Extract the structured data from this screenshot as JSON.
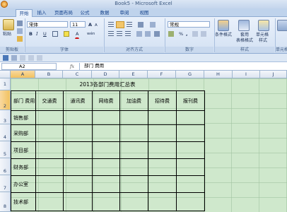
{
  "app": {
    "title": "Book5 - Microsoft Excel"
  },
  "tabs": [
    "开始",
    "插入",
    "页面布局",
    "公式",
    "数据",
    "审阅",
    "视图"
  ],
  "ribbon": {
    "clipboard": {
      "paste": "粘贴",
      "label": "剪贴板"
    },
    "font": {
      "name": "宋体",
      "size": "11",
      "label": "字体",
      "bold": "B",
      "italic": "I",
      "underline": "U",
      "grow": "A",
      "shrink": "A",
      "font_color": "A",
      "wen": "wén"
    },
    "alignment": {
      "label": "对齐方式"
    },
    "number": {
      "format": "常规",
      "percent": "%",
      "comma": ",",
      "label": "数字"
    },
    "styles": {
      "conditional": "条件格式",
      "table_line1": "套用",
      "table_line2": "表格格式",
      "cell_line1": "单元格",
      "cell_line2": "样式",
      "label": "样式"
    },
    "cells": {
      "label": "单元格"
    }
  },
  "formula_bar": {
    "name_box": "A2",
    "fx": "fx",
    "content": "部门 费用"
  },
  "columns": [
    "A",
    "B",
    "C",
    "D",
    "E",
    "F",
    "G",
    "H",
    "I",
    "J"
  ],
  "rows": [
    "1",
    "2",
    "3",
    "4",
    "5",
    "6",
    "7",
    "8"
  ],
  "sheet": {
    "title": "2013各部门费用汇总表",
    "header": [
      "部门 费用",
      "交通费",
      "通讯费",
      "网络费",
      "加油费",
      "招待费",
      "报刊费"
    ],
    "departments": [
      "销售部",
      "采购部",
      "项目部",
      "财务部",
      "办公室",
      "技术部"
    ]
  },
  "colors": {
    "accent": "#15428b",
    "sheet_bg": "#cfe8cc",
    "selected_header": "#f1c15f"
  }
}
